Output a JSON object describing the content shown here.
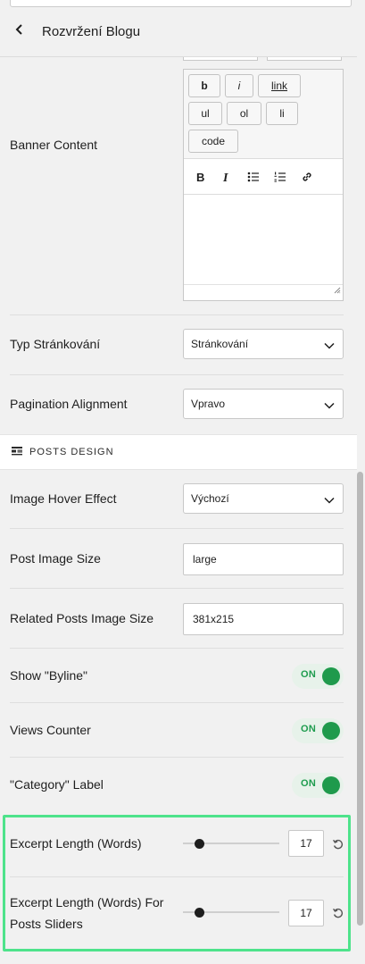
{
  "header": {
    "title": "Rozvržení Blogu",
    "back_icon": "chevron-left-icon"
  },
  "banner": {
    "label": "Banner Content",
    "quicktags": [
      "b",
      "i",
      "link",
      "ul",
      "ol",
      "li",
      "code"
    ],
    "toolbar_icons": [
      "bold-icon",
      "italic-icon",
      "bulleted-list-icon",
      "numbered-list-icon",
      "link-icon"
    ]
  },
  "pagination_type": {
    "label": "Typ Stránkování",
    "value": "Stránkování"
  },
  "pagination_alignment": {
    "label": "Pagination Alignment",
    "value": "Vpravo"
  },
  "posts_design": {
    "title": "POSTS DESIGN"
  },
  "image_hover": {
    "label": "Image Hover Effect",
    "value": "Výchozí"
  },
  "post_image_size": {
    "label": "Post Image Size",
    "value": "large"
  },
  "related_image_size": {
    "label": "Related Posts Image Size",
    "value": "381x215"
  },
  "toggles": [
    {
      "label": "Show \"Byline\"",
      "state": "ON"
    },
    {
      "label": "Views Counter",
      "state": "ON"
    },
    {
      "label": "\"Category\" Label",
      "state": "ON"
    }
  ],
  "excerpt": {
    "label": "Excerpt Length (Words)",
    "value": "17",
    "min": 0,
    "max": 100
  },
  "excerpt_sliders": {
    "label_line1": "Excerpt Length (Words) For",
    "label_line2": "Posts Sliders",
    "value": "17",
    "min": 0,
    "max": 100
  },
  "colors": {
    "accent_green": "#1f9a4c",
    "highlight": "#4ee38b"
  }
}
